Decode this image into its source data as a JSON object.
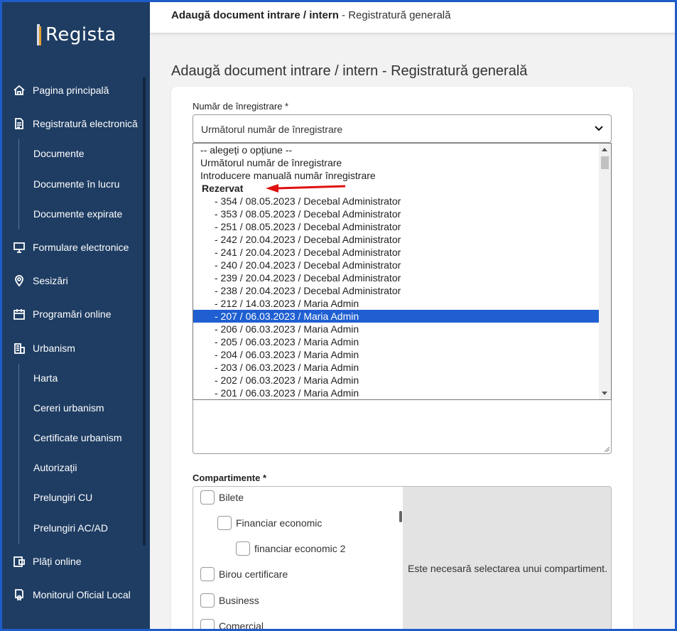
{
  "app": {
    "logo_text": "Regista"
  },
  "header": {
    "crumb_bold": "Adaugă document intrare / intern",
    "crumb_rest": " - Registratură generală"
  },
  "page": {
    "title": "Adaugă document intrare / intern - Registratură generală"
  },
  "sidebar": {
    "items": [
      {
        "label": "Pagina principală",
        "icon": "home-icon"
      },
      {
        "label": "Registratură electronică",
        "icon": "document-icon"
      },
      {
        "label": "Documente"
      },
      {
        "label": "Documente în lucru"
      },
      {
        "label": "Documente expirate"
      },
      {
        "label": "Formulare electronice",
        "icon": "monitor-icon"
      },
      {
        "label": "Sesizări",
        "icon": "map-pin-icon"
      },
      {
        "label": "Programări online",
        "icon": "calendar-icon"
      },
      {
        "label": "Urbanism",
        "icon": "building-icon"
      },
      {
        "label": "Harta"
      },
      {
        "label": "Cereri urbanism"
      },
      {
        "label": "Certificate urbanism"
      },
      {
        "label": "Autorizații"
      },
      {
        "label": "Prelungiri CU"
      },
      {
        "label": "Prelungiri AC/AD"
      },
      {
        "label": "Plăți online",
        "icon": "payment-icon"
      },
      {
        "label": "Monitorul Oficial Local",
        "icon": "certificate-icon"
      }
    ]
  },
  "form": {
    "numar_label": "Număr de înregistrare *",
    "numar_value": "Următorul număr de înregistrare",
    "options": [
      "-- alegeți o opțiune --",
      "Următorul număr de înregistrare",
      "Introducere manuală număr înregistrare",
      "Rezervat",
      "- 354 / 08.05.2023 / Decebal Administrator",
      "- 353 / 08.05.2023 / Decebal Administrator",
      "- 251 / 08.05.2023 / Decebal Administrator",
      "- 242 / 20.04.2023 / Decebal Administrator",
      "- 241 / 20.04.2023 / Decebal Administrator",
      "- 240 / 20.04.2023 / Decebal Administrator",
      "- 239 / 20.04.2023 / Decebal Administrator",
      "- 238 / 20.04.2023 / Decebal Administrator",
      "- 212 / 14.03.2023 / Maria Admin",
      "- 207 / 06.03.2023 / Maria Admin",
      "- 206 / 06.03.2023 / Maria Admin",
      "- 205 / 06.03.2023 / Maria Admin",
      "- 204 / 06.03.2023 / Maria Admin",
      "- 203 / 06.03.2023 / Maria Admin",
      "- 202 / 06.03.2023 / Maria Admin",
      "- 201 / 06.03.2023 / Maria Admin"
    ],
    "selected_option": "- 207 / 06.03.2023 / Maria Admin",
    "compartimente_label": "Compartimente *",
    "compartimente": [
      {
        "label": "Bilete",
        "level": 0
      },
      {
        "label": "Financiar economic",
        "level": 1
      },
      {
        "label": "financiar economic 2",
        "level": 2
      },
      {
        "label": "Birou certificare",
        "level": 0
      },
      {
        "label": "Business",
        "level": 0
      },
      {
        "label": "Comercial",
        "level": 0
      }
    ],
    "compartiment_message": "Este necesară selectarea unui compartiment.",
    "accent_color": "#1f5fd1",
    "arrow_color": "#e01010"
  }
}
